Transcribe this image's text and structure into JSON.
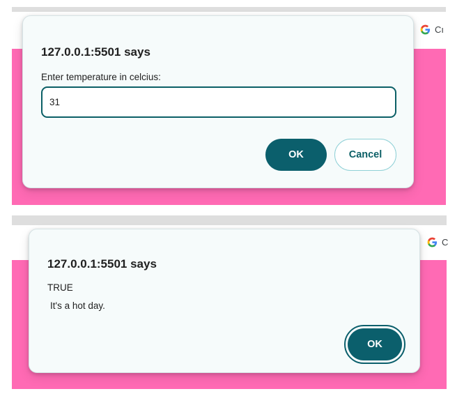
{
  "colors": {
    "page_background": "#ff6ab4",
    "tab_strip": "#dedede",
    "dialog_background": "#f6fbfb",
    "primary_button": "#0b5f6c",
    "input_border": "#0b5f66"
  },
  "prompt_screen": {
    "google_badge": {
      "icon": "google-g-icon",
      "text": "Cı"
    },
    "dialog": {
      "title": "127.0.0.1:5501 says",
      "message": "Enter temperature in celcius:",
      "input_value": "31",
      "ok_label": "OK",
      "cancel_label": "Cancel"
    }
  },
  "alert_screen": {
    "google_badge": {
      "icon": "google-g-icon",
      "text": "C"
    },
    "dialog": {
      "title": "127.0.0.1:5501 says",
      "message_lines": [
        "TRUE",
        "It's a hot day."
      ],
      "ok_label": "OK"
    }
  }
}
